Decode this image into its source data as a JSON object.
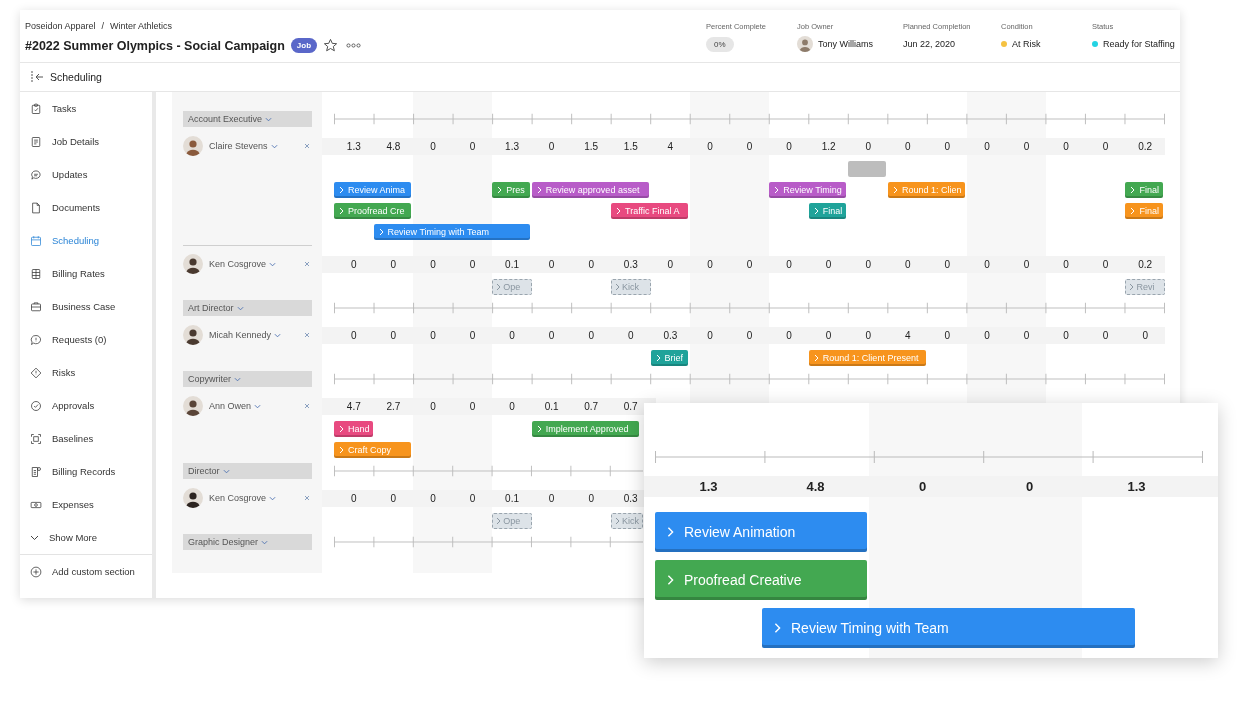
{
  "breadcrumb": {
    "items": [
      "Poseidon Apparel",
      "Winter Athletics"
    ],
    "separator": "/"
  },
  "title": "#2022 Summer Olympics - Social Campaign",
  "badge": "Job",
  "summary": [
    {
      "label": "Percent Complete",
      "value": "0%",
      "kind": "pill"
    },
    {
      "label": "Job Owner",
      "value": "Tony Williams",
      "kind": "person"
    },
    {
      "label": "Planned Completion",
      "value": "Jun 22, 2020",
      "kind": "text"
    },
    {
      "label": "Condition",
      "value": "At Risk",
      "kind": "dot",
      "color": "#f5c242"
    },
    {
      "label": "Status",
      "value": "Ready for Staffing",
      "kind": "dot",
      "color": "#23d3e3"
    }
  ],
  "section_bar": {
    "title": "Scheduling"
  },
  "sidebar": {
    "items": [
      {
        "label": "Tasks",
        "selected": false
      },
      {
        "label": "Job Details",
        "selected": false
      },
      {
        "label": "Updates",
        "selected": false
      },
      {
        "label": "Documents",
        "selected": false
      },
      {
        "label": "Scheduling",
        "selected": true
      },
      {
        "label": "Billing Rates",
        "selected": false
      },
      {
        "label": "Business Case",
        "selected": false
      },
      {
        "label": "Requests (0)",
        "selected": false
      },
      {
        "label": "Risks",
        "selected": false
      },
      {
        "label": "Approvals",
        "selected": false
      },
      {
        "label": "Baselines",
        "selected": false
      },
      {
        "label": "Billing Records",
        "selected": false
      },
      {
        "label": "Expenses",
        "selected": false
      }
    ],
    "show_more": "Show More",
    "add_section": "Add custom section"
  },
  "schedule": {
    "groups": [
      {
        "role": "Account Executive",
        "people": [
          {
            "name": "Claire Stevens",
            "hours": [
              "1.3",
              "4.8",
              "0",
              "0",
              "1.3",
              "0",
              "1.5",
              "1.5",
              "4",
              "0",
              "0",
              "0",
              "1.2",
              "0",
              "0",
              "0",
              "0",
              "0",
              "0",
              "0",
              "0.2"
            ],
            "task_rows": [
              [
                {
                  "kind": "placeholder",
                  "color": "#bdbdbd"
                }
              ],
              [
                {
                  "kind": "task",
                  "label": "Review Anima",
                  "color": "#2d8cf0"
                },
                {
                  "kind": "task",
                  "label": "Pres",
                  "color": "#43a851"
                },
                {
                  "kind": "task",
                  "label": "Review approved asset",
                  "color": "#b85cc8"
                },
                {
                  "kind": "task",
                  "label": "Review Timing",
                  "color": "#b85cc8"
                },
                {
                  "kind": "task",
                  "label": "Round 1: Clien",
                  "color": "#f7941d"
                },
                {
                  "kind": "task",
                  "label": "Final",
                  "color": "#43a851"
                }
              ],
              [
                {
                  "kind": "task",
                  "label": "Proofread Cre",
                  "color": "#43a851"
                },
                {
                  "kind": "task",
                  "label": "Traffic Final A",
                  "color": "#e84a80"
                },
                {
                  "kind": "task",
                  "label": "Final",
                  "color": "#1fa39a"
                },
                {
                  "kind": "task",
                  "label": "Final",
                  "color": "#f7941d"
                }
              ],
              [
                {
                  "kind": "task",
                  "label": "Review Timing with Team",
                  "color": "#2d8cf0"
                }
              ]
            ]
          },
          {
            "name": "Ken Cosgrove",
            "hours": [
              "0",
              "0",
              "0",
              "0",
              "0.1",
              "0",
              "0",
              "0.3",
              "0",
              "0",
              "0",
              "0",
              "0",
              "0",
              "0",
              "0",
              "0",
              "0",
              "0",
              "0",
              "0.2"
            ],
            "task_rows": [
              [
                {
                  "kind": "tentative",
                  "label": "Ope"
                },
                {
                  "kind": "tentative",
                  "label": "Kick"
                },
                {
                  "kind": "tentative",
                  "label": "Revi"
                }
              ]
            ]
          }
        ]
      },
      {
        "role": "Art Director",
        "people": [
          {
            "name": "Micah Kennedy",
            "hours": [
              "0",
              "0",
              "0",
              "0",
              "0",
              "0",
              "0",
              "0",
              "0.3",
              "0",
              "0",
              "0",
              "0",
              "0",
              "4",
              "0",
              "0",
              "0",
              "0",
              "0",
              "0"
            ],
            "task_rows": [
              [
                {
                  "kind": "task",
                  "label": "Brief",
                  "color": "#1fa39a"
                },
                {
                  "kind": "task",
                  "label": "Round 1: Client Present",
                  "color": "#f7941d"
                }
              ]
            ]
          }
        ]
      },
      {
        "role": "Copywriter",
        "people": [
          {
            "name": "Ann Owen",
            "hours": [
              "4.7",
              "2.7",
              "0",
              "0",
              "0",
              "0.1",
              "0.7",
              "0.7"
            ],
            "task_rows": [
              [
                {
                  "kind": "task",
                  "label": "Hand",
                  "color": "#e84a80"
                },
                {
                  "kind": "task",
                  "label": "Implement Approved",
                  "color": "#43a851"
                }
              ],
              [
                {
                  "kind": "task",
                  "label": "Craft Copy",
                  "color": "#f7941d"
                }
              ]
            ]
          }
        ]
      },
      {
        "role": "Director",
        "people": [
          {
            "name": "Ken Cosgrove",
            "hours": [
              "0",
              "0",
              "0",
              "0",
              "0.1",
              "0",
              "0",
              "0.3"
            ],
            "task_rows": [
              [
                {
                  "kind": "tentative",
                  "label": "Ope"
                },
                {
                  "kind": "tentative",
                  "label": "Kick"
                }
              ]
            ]
          }
        ]
      },
      {
        "role": "Graphic Designer"
      }
    ]
  },
  "zoom_detail": {
    "hours": [
      "1.3",
      "4.8",
      "0",
      "0",
      "1.3"
    ],
    "tasks": [
      {
        "kind": "task",
        "label": "Review Animation",
        "color": "#2d8cf0"
      },
      {
        "kind": "task",
        "label": "Proofread Creative",
        "color": "#43a851"
      },
      {
        "kind": "task",
        "label": "Review Timing with Team",
        "color": "#2d8cf0"
      }
    ]
  }
}
